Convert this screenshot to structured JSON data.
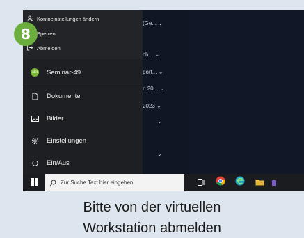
{
  "step_badge": "8",
  "desktop_items": [
    "(Ge...",
    "ch...",
    "port...",
    "n 20...",
    "2023"
  ],
  "submenu": {
    "items": [
      {
        "label": "Kontoeinstellungen ändern",
        "icon": "account-settings-icon"
      },
      {
        "label": "Sperren",
        "icon": "lock-icon"
      },
      {
        "label": "Abmelden",
        "icon": "sign-out-icon"
      }
    ]
  },
  "start_menu": {
    "user": {
      "label": "Seminar-49",
      "avatar_text": "ARI"
    },
    "items": [
      {
        "label": "Dokumente",
        "icon": "document-icon"
      },
      {
        "label": "Bilder",
        "icon": "pictures-icon"
      },
      {
        "label": "Einstellungen",
        "icon": "gear-icon"
      },
      {
        "label": "Ein/Aus",
        "icon": "power-icon"
      }
    ]
  },
  "taskbar": {
    "search_placeholder": "Zur Suche Text hier eingeben"
  },
  "caption": {
    "line1": "Bitte von der virtuellen",
    "line2": "Workstation abmelden"
  },
  "colors": {
    "badge": "#6cae3e",
    "background": "#dde6ee",
    "start_panel": "#1d1f22",
    "taskbar": "#1b1c1f"
  }
}
